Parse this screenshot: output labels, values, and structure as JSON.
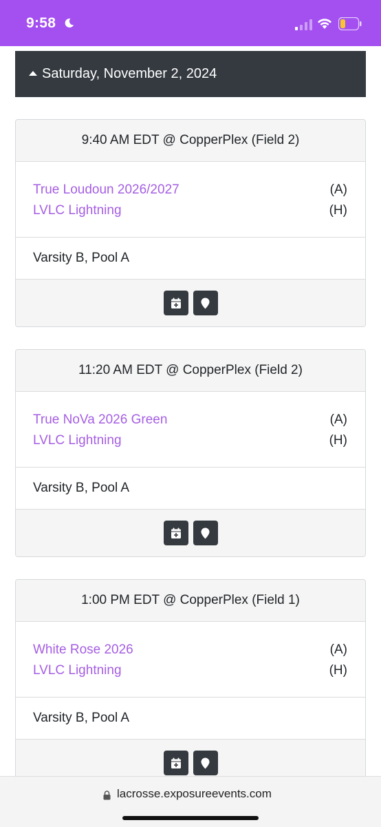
{
  "status_bar": {
    "time": "9:58",
    "background": "#a44ff0"
  },
  "day_header": {
    "label": "Saturday, November 2, 2024"
  },
  "games": [
    {
      "time_location": "9:40 AM EDT @ CopperPlex (Field 2)",
      "away_team": "True Loudoun 2026/2027",
      "away_tag": "(A)",
      "home_team": "LVLC Lightning",
      "home_tag": "(H)",
      "division": "Varsity B, Pool A"
    },
    {
      "time_location": "11:20 AM EDT @ CopperPlex (Field 2)",
      "away_team": "True NoVa 2026 Green",
      "away_tag": "(A)",
      "home_team": "LVLC Lightning",
      "home_tag": "(H)",
      "division": "Varsity B, Pool A"
    },
    {
      "time_location": "1:00 PM EDT @ CopperPlex (Field 1)",
      "away_team": "White Rose 2026",
      "away_tag": "(A)",
      "home_team": "LVLC Lightning",
      "home_tag": "(H)",
      "division": "Varsity B, Pool A"
    }
  ],
  "url_bar": {
    "url": "lacrosse.exposureevents.com"
  },
  "colors": {
    "link": "#a55ee3",
    "dark": "#343a40"
  }
}
